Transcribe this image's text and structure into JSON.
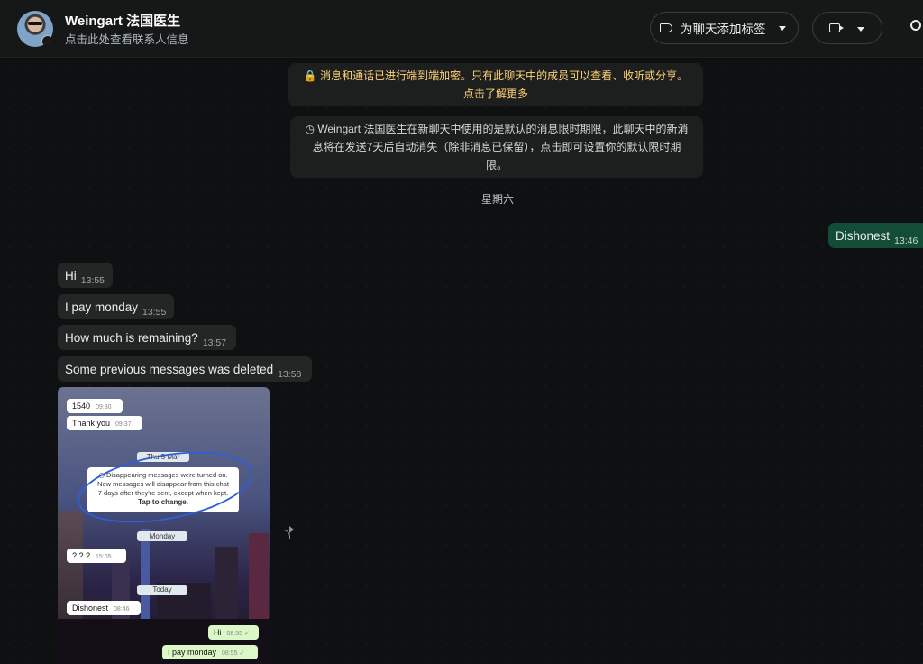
{
  "header": {
    "contact_name": "Weingart 法国医生",
    "contact_sub": "点击此处查看联系人信息",
    "label_button": "为聊天添加标签"
  },
  "icons": [
    "timer-icon",
    "tag-icon",
    "video-camera-icon",
    "chevron-down-icon",
    "search-icon",
    "lock-icon",
    "forward-icon"
  ],
  "system": {
    "encryption_notice": "🔒 消息和通话已进行端到端加密。只有此聊天中的成员可以查看、收听或分享。点击了解更多",
    "disappearing_notice": "◷ Weingart 法国医生在新聊天中使用的是默认的消息限时期限，此聊天中的新消息将在发送7天后自动消失（除非消息已保留），点击即可设置你的默认限时期限。"
  },
  "date_divider": "星期六",
  "messages": [
    {
      "text": "Dishonest",
      "time": "13:46",
      "direction": "outgoing"
    },
    {
      "text": "Hi",
      "time": "13:55",
      "direction": "incoming"
    },
    {
      "text": "I pay monday",
      "time": "13:55",
      "direction": "incoming"
    },
    {
      "text": "How much is remaining?",
      "time": "13:57",
      "direction": "incoming"
    },
    {
      "text": "Some previous messages was deleted",
      "time": "13:58",
      "direction": "incoming"
    }
  ],
  "screenshot_image": {
    "msg_1540": "1540",
    "time_1540": "09:30",
    "msg_thankyou": "Thank you",
    "time_thankyou": "09:37",
    "date_thu": "Thu 5 Mar",
    "note_line1": "◷ Disappearing messages were turned on.",
    "note_line2": "New messages will disappear from this chat",
    "note_line3": "7 days after they're sent, except when kept.",
    "note_tap": "Tap to change.",
    "date_monday": "Monday",
    "msg_question": "? ? ?",
    "time_question": "15:05",
    "date_today": "Today",
    "msg_dishonest": "Dishonest",
    "time_dishonest": "08:46",
    "msg_hi": "Hi",
    "time_hi": "08:55 ✓",
    "msg_pay": "I pay monday",
    "time_pay": "08:55 ✓"
  },
  "colors": {
    "background": "#0f1011",
    "header": "#161717",
    "incoming_bubble": "#242626",
    "outgoing_bubble": "#144d37",
    "encryption_text": "#ffd279"
  }
}
